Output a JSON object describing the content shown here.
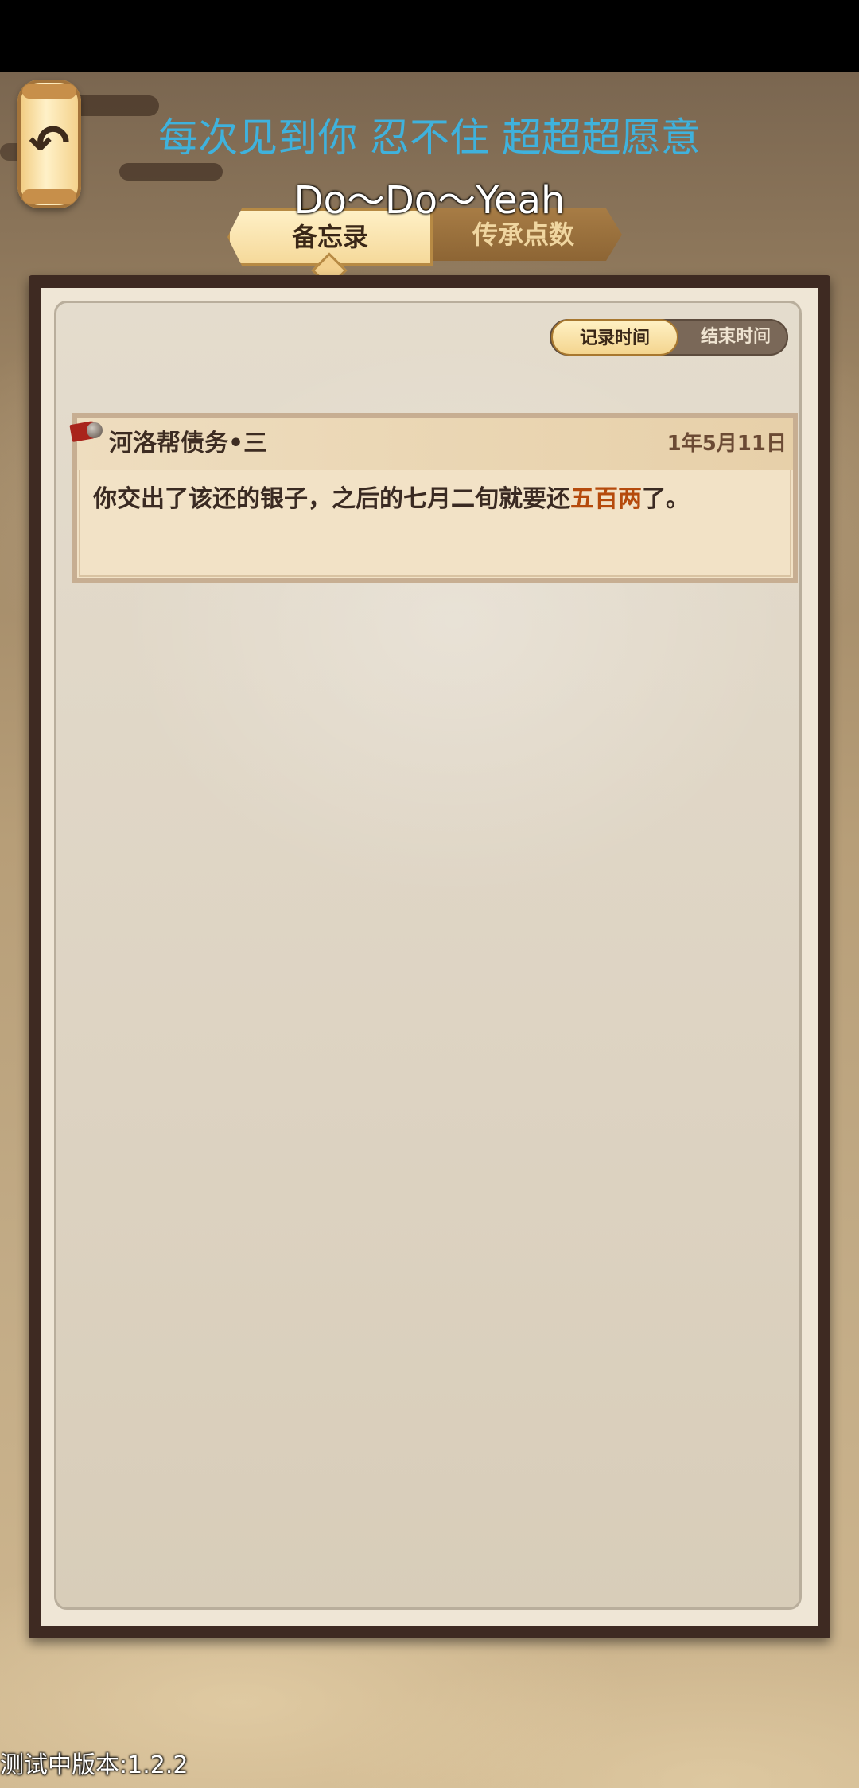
{
  "overlay": {
    "lyric_line": "每次见到你 忍不住 超超超愿意",
    "lyric_sub": "Do～Do～Yeah"
  },
  "back_button": {
    "icon": "back-arrow-icon",
    "glyph": "↶"
  },
  "tabs": [
    {
      "label": "备忘录",
      "selected": true
    },
    {
      "label": "传承点数",
      "selected": false
    }
  ],
  "sort_toggle": {
    "options": [
      "记录时间",
      "结束时间"
    ],
    "selected": "记录时间"
  },
  "memos": [
    {
      "title": "河洛帮债务•三",
      "date": "1年5月11日",
      "body_before": "你交出了该还的银子，之后的七月二旬就要还",
      "body_highlight": "五百两",
      "body_after": "了。"
    }
  ],
  "footer": {
    "version": "测试中版本:1.2.2"
  },
  "colors": {
    "lyric": "#3fb2dd",
    "highlight": "#b54a0c",
    "frame": "#3e2a22"
  }
}
